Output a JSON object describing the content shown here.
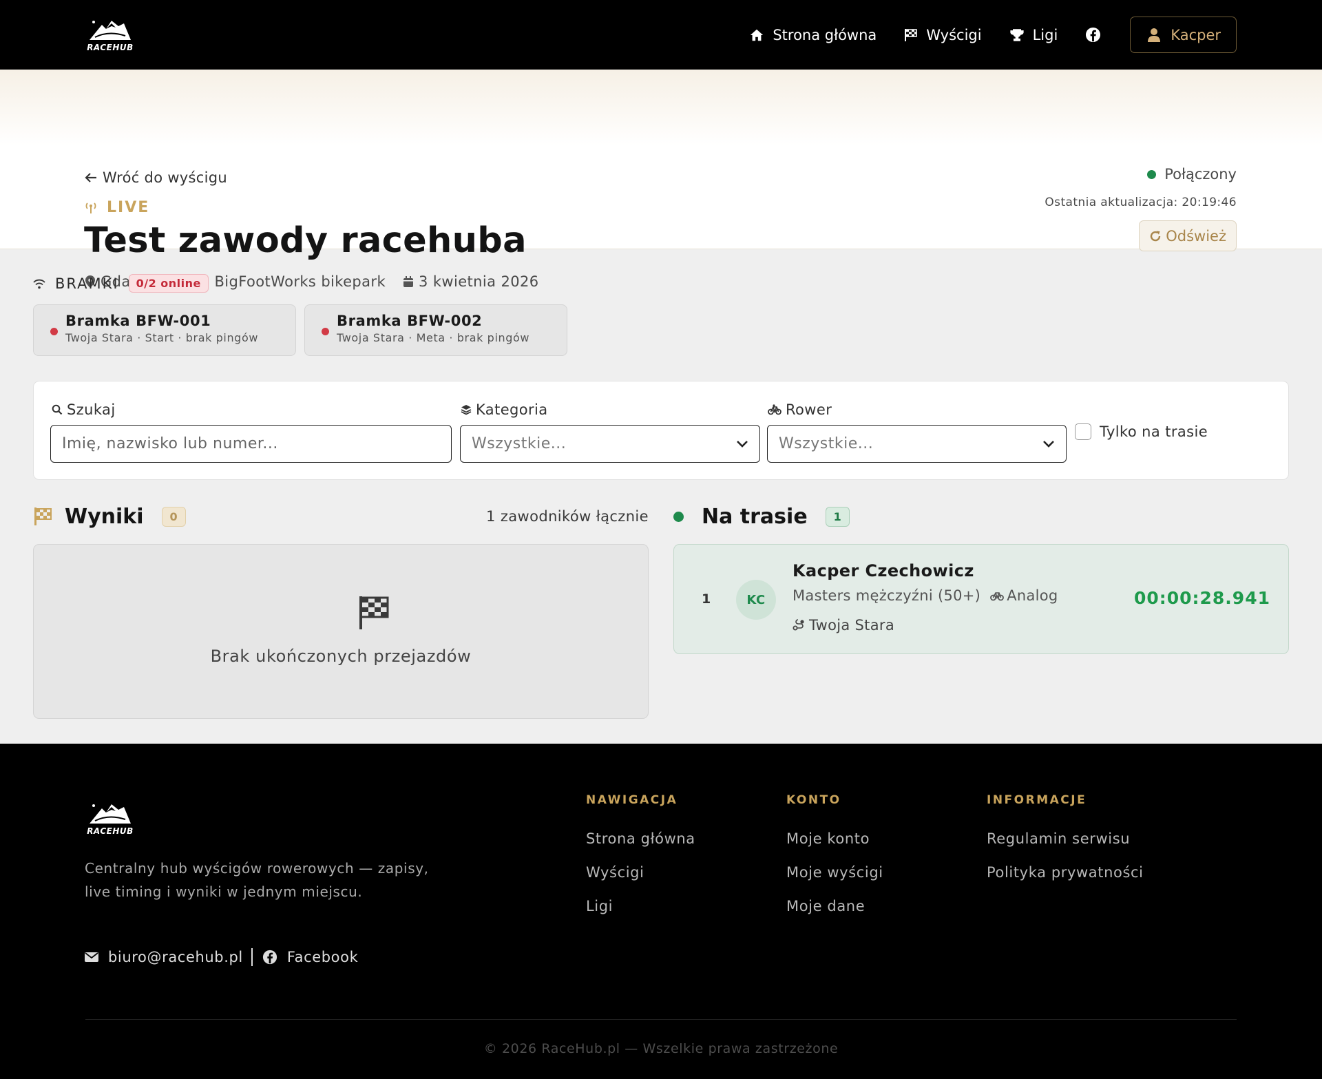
{
  "brand": {
    "name": "RACEHUB"
  },
  "nav": {
    "links": [
      {
        "label": "Strona główna",
        "icon": "home-icon"
      },
      {
        "label": "Wyścigi",
        "icon": "flag-checkered-icon"
      },
      {
        "label": "Ligi",
        "icon": "trophy-icon"
      }
    ],
    "facebook_icon": "facebook-icon",
    "user": {
      "label": "Kacper",
      "icon": "user-icon"
    }
  },
  "hero": {
    "back_label": "Wróć do wyścigu",
    "live_label": "LIVE",
    "title": "Test zawody racehuba",
    "location": "Gdańsk/Sopot, BigFootWorks bikepark",
    "date": "3 kwietnia 2026",
    "status": "Połączony",
    "last_update": "Ostatnia aktualizacja: 20:19:46",
    "refresh_label": "Odśwież"
  },
  "gates": {
    "title": "BRAMKI",
    "badge": "0/2 online",
    "items": [
      {
        "name": "Bramka BFW-001",
        "sub": "Twoja Stara · Start · brak pingów"
      },
      {
        "name": "Bramka BFW-002",
        "sub": "Twoja Stara · Meta · brak pingów"
      }
    ]
  },
  "filters": {
    "search_label": "Szukaj",
    "search_placeholder": "Imię, nazwisko lub numer...",
    "category_label": "Kategoria",
    "category_value": "Wszystkie...",
    "bike_label": "Rower",
    "bike_value": "Wszystkie...",
    "only_on_track_label": "Tylko na trasie"
  },
  "results": {
    "title": "Wyniki",
    "count": "0",
    "total": "1 zawodników łącznie",
    "empty_message": "Brak ukończonych przejazdów"
  },
  "on_track": {
    "title": "Na trasie",
    "count": "1",
    "riders": [
      {
        "position": "1",
        "initials": "KC",
        "name": "Kacper Czechowicz",
        "category": "Masters mężczyźni (50+)",
        "bike": "Analog",
        "route": "Twoja Stara",
        "time": "00:00:28.941"
      }
    ]
  },
  "footer": {
    "description": "Centralny hub wyścigów rowerowych — zapisy, live timing i wyniki w jednym miejscu.",
    "email": "biuro@racehub.pl",
    "facebook": "Facebook",
    "columns": [
      {
        "heading": "NAWIGACJA",
        "links": [
          "Strona główna",
          "Wyścigi",
          "Ligi"
        ]
      },
      {
        "heading": "KONTO",
        "links": [
          "Moje konto",
          "Moje wyścigi",
          "Moje dane"
        ]
      },
      {
        "heading": "INFORMACJE",
        "links": [
          "Regulamin serwisu",
          "Polityka prywatności"
        ]
      }
    ],
    "copyright": "© 2026 RaceHub.pl — Wszelkie prawa zastrzeżone"
  },
  "colors": {
    "accent_gold": "#c9a45c",
    "online_green": "#1e8a4c",
    "offline_red": "#d23b46",
    "timer_green": "#1e9a4c"
  }
}
